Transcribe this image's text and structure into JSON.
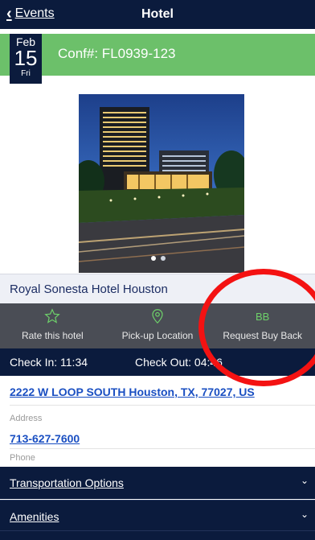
{
  "nav": {
    "back_label": "Events",
    "title": "Hotel"
  },
  "booking": {
    "month": "Feb",
    "day": "15",
    "weekday": "Fri",
    "confirmation": "Conf#: FL0939-123"
  },
  "hotel": {
    "name": "Royal Sonesta Hotel Houston"
  },
  "actions": [
    {
      "icon": "star-icon",
      "label": "Rate this hotel"
    },
    {
      "icon": "location-pin-icon",
      "label": "Pick-up Location"
    },
    {
      "icon": "bb-icon",
      "icon_text": "BB",
      "label": "Request Buy Back"
    }
  ],
  "stay": {
    "check_in": "Check In: 11:34",
    "check_out": "Check Out: 04:46"
  },
  "contact": {
    "address": "2222 W LOOP SOUTH Houston, TX, 77027, US",
    "address_label": "Address",
    "phone": "713-627-7600",
    "phone_label": "Phone"
  },
  "sections": [
    {
      "label": "Transportation Options"
    },
    {
      "label": "Amenities"
    }
  ],
  "carousel": {
    "count": 2,
    "active_index": 1
  },
  "colors": {
    "navy": "#0b1b3d",
    "green": "#6cc06a",
    "link": "#1a4fc2",
    "annotation": "#f41212"
  }
}
